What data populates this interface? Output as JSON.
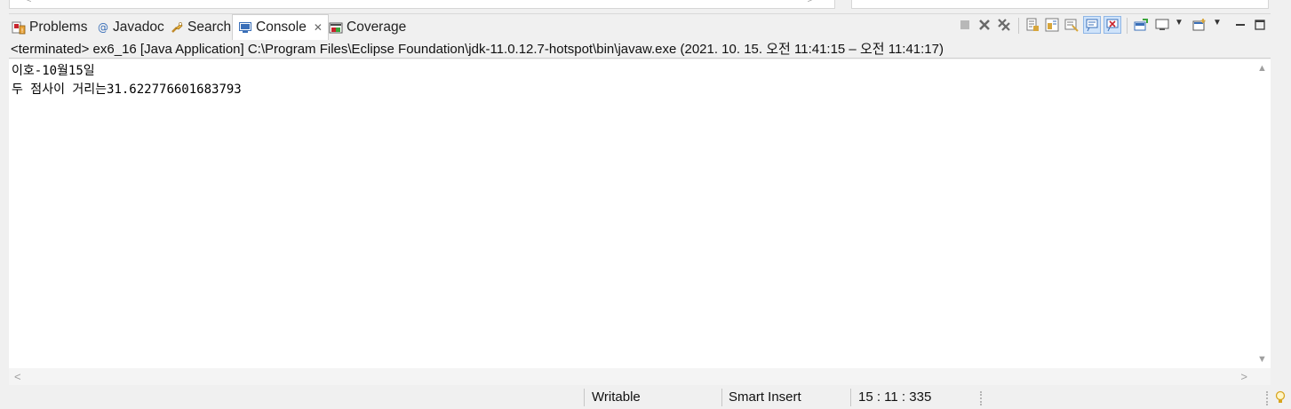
{
  "tabs": [
    {
      "label": "Problems",
      "icon": "problems-icon"
    },
    {
      "label": "Javadoc",
      "icon": "javadoc-icon"
    },
    {
      "label": "Search",
      "icon": "search-icon"
    },
    {
      "label": "Console",
      "icon": "console-icon",
      "active": true
    },
    {
      "label": "Coverage",
      "icon": "coverage-icon"
    }
  ],
  "info_line": "<terminated> ex6_16 [Java Application] C:\\Program Files\\Eclipse Foundation\\jdk-11.0.12.7-hotspot\\bin\\javaw.exe  (2021. 10. 15. 오전 11:41:15 – 오전 11:41:17)",
  "console_output": [
    "이호-10월15일",
    "두 점사이 거리는31.622776601683793"
  ],
  "status": {
    "writable": "Writable",
    "insert_mode": "Smart Insert",
    "position": "15 : 11 : 335"
  },
  "toolbar_icons": [
    "terminate-icon",
    "remove-launch-icon",
    "remove-all-terminated-icon",
    "scroll-lock-icon",
    "word-wrap-icon",
    "pin-console-icon",
    "show-on-stdout-icon",
    "show-on-stderr-icon",
    "open-console-icon",
    "display-console-icon",
    "new-console-icon",
    "minimize-icon",
    "maximize-icon"
  ],
  "colors": {
    "accent_blue": "#3a6fb8",
    "error_red": "#c8232c",
    "toggle_bg": "#cfe3fa"
  }
}
